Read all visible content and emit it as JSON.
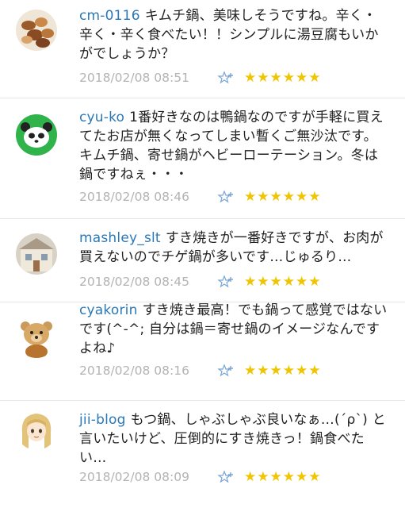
{
  "comments": [
    {
      "user": "cm-0116",
      "text": "キムチ鍋、美味しそうですね。辛く・辛く・辛く食べたい！！シンプルに湯豆腐もいかがでしょうか？",
      "date": "2018/02/08 08:51",
      "avatar": "nuts-avatar",
      "rating": "★★★★★★"
    },
    {
      "user": "cyu-ko",
      "text": "1番好きなのは鴨鍋なのですが手軽に買えてたお店が無くなってしまい暫くご無沙汰です。キムチ鍋、寄せ鍋がヘビーローテーション。冬は鍋ですねぇ・・・",
      "date": "2018/02/08 08:46",
      "avatar": "panda-avatar",
      "rating": "★★★★★★"
    },
    {
      "user": "mashley_slt",
      "text": "すき焼きが一番好きですが、お肉が買えないのでチゲ鍋が多いです…じゅるり…",
      "date": "2018/02/08 08:45",
      "avatar": "house-avatar",
      "rating": "★★★★★★"
    },
    {
      "user": "cyakorin",
      "text": "すき焼き最高！でも鍋って感覚ではないです(^-^; 自分は鍋＝寄せ鍋のイメージなんですよね♪",
      "date": "2018/02/08 08:16",
      "avatar": "teddy-bear-avatar",
      "rating": "★★★★★★"
    },
    {
      "user": "jii-blog",
      "text": "もつ鍋、しゃぶしゃぶ良いなぁ…(´ρ`) と言いたいけど、圧倒的にすき焼きっ！鍋食べたい…",
      "date": "2018/02/08 08:09",
      "avatar": "anime-girl-avatar",
      "rating": "★★★★★★"
    }
  ]
}
